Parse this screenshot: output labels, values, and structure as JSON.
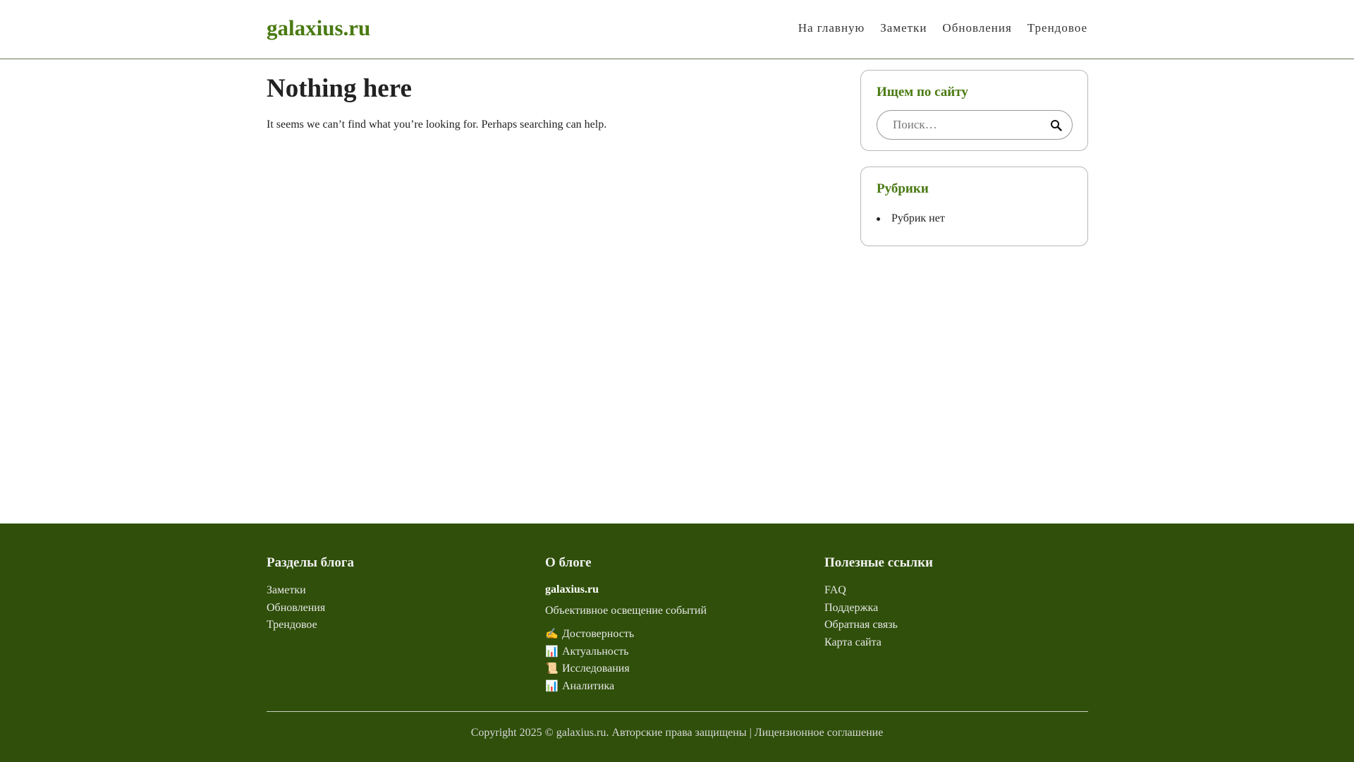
{
  "header": {
    "logo": "galaxius.ru",
    "nav": [
      "На главную",
      "Заметки",
      "Обновления",
      "Трендовое"
    ]
  },
  "main": {
    "title": "Nothing here",
    "text": "It seems we can’t find what you’re looking for. Perhaps searching can help."
  },
  "sidebar": {
    "search": {
      "title": "Ищем по сайту",
      "placeholder": "Поиск…",
      "icon": "search-icon"
    },
    "categories": {
      "title": "Рубрики",
      "items": [
        "Рубрик нет"
      ]
    }
  },
  "footer": {
    "col1": {
      "title": "Разделы блога",
      "links": [
        "Заметки",
        "Обновления",
        "Трендовое"
      ]
    },
    "col2": {
      "title": "О блоге",
      "brand": "galaxius.ru",
      "tagline": "Объективное освещение событий",
      "features": [
        {
          "icon": "✍️",
          "label": "Достоверность"
        },
        {
          "icon": "📊",
          "label": "Актуальность"
        },
        {
          "icon": "📜",
          "label": "Исследования"
        },
        {
          "icon": "📊",
          "label": "Аналитика"
        }
      ]
    },
    "col3": {
      "title": "Полезные ссылки",
      "links": [
        "FAQ",
        "Поддержка",
        "Обратная связь",
        "Карта сайта"
      ]
    },
    "copyright": "Copyright 2025 © galaxius.ru. Авторские права защищены | Лицензионное соглашение"
  },
  "colors": {
    "accent": "#4a7a12",
    "footer_bg": "#2f4f0a"
  }
}
